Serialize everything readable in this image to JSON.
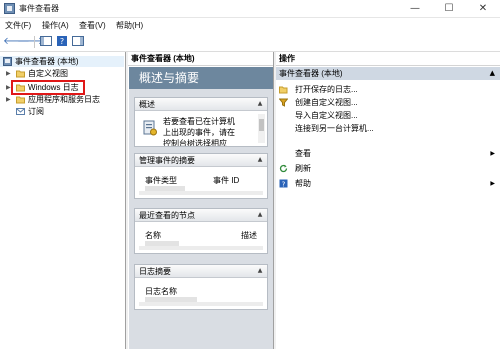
{
  "window": {
    "title": "事件查看器",
    "minimize": "—",
    "maximize": "☐",
    "close": "✕"
  },
  "menu": {
    "file": "文件(F)",
    "action": "操作(A)",
    "view": "查看(V)",
    "help": "帮助(H)"
  },
  "toolbar": {
    "back_icon": "arrow-left-icon",
    "forward_icon": "arrow-right-icon"
  },
  "tree": {
    "root": "事件查看器 (本地)",
    "items": [
      {
        "label": "自定义视图",
        "expandable": true
      },
      {
        "label": "Windows 日志",
        "expandable": true
      },
      {
        "label": "应用程序和服务日志",
        "expandable": true
      },
      {
        "label": "订阅",
        "expandable": false
      }
    ]
  },
  "middle": {
    "header": "事件查看器 (本地)",
    "banner": "概述与摘要",
    "sections": {
      "overview": {
        "title": "概述",
        "text_lines": [
          "若要查看已在计算机",
          "上出现的事件，请在",
          "控制台树选择相应"
        ]
      },
      "admin_events": {
        "title": "管理事件的摘要",
        "columns": [
          "事件类型",
          "事件 ID"
        ]
      },
      "recent_nodes": {
        "title": "最近查看的节点",
        "columns": [
          "名称",
          "描述"
        ]
      },
      "log_summary": {
        "title": "日志摘要",
        "columns": [
          "日志名称"
        ]
      }
    }
  },
  "actions": {
    "header": "操作",
    "group": "事件查看器 (本地)",
    "items": [
      {
        "label": "打开保存的日志...",
        "icon": "folder-open-icon",
        "submenu": false
      },
      {
        "label": "创建自定义视图...",
        "icon": "filter-icon",
        "submenu": false
      },
      {
        "label": "导入自定义视图...",
        "icon": "",
        "submenu": false
      },
      {
        "label": "连接到另一台计算机...",
        "icon": "",
        "submenu": false
      },
      {
        "label": "查看",
        "icon": "",
        "submenu": true
      },
      {
        "label": "刷新",
        "icon": "refresh-icon",
        "submenu": false
      },
      {
        "label": "帮助",
        "icon": "help-icon",
        "submenu": true
      }
    ]
  },
  "colors": {
    "banner": "#6d879e",
    "selection": "#e5f1fb",
    "actions_group": "#cfd8e3",
    "highlight_border": "#e01818"
  }
}
